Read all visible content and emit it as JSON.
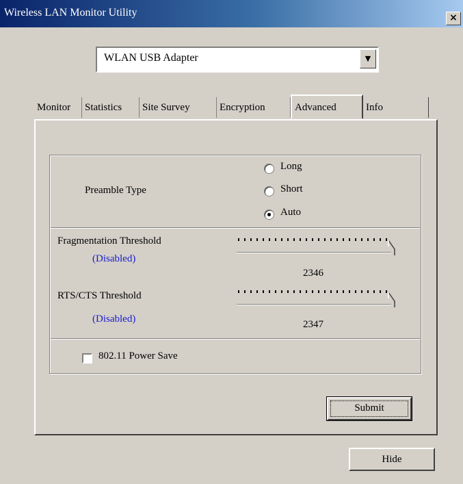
{
  "window": {
    "title": "Wireless LAN Monitor Utility",
    "close_symbol": "×"
  },
  "adapter_select": {
    "value": "WLAN USB Adapter",
    "arrow": "▼"
  },
  "tabs": [
    {
      "label": "Monitor"
    },
    {
      "label": "Statistics"
    },
    {
      "label": "Site Survey"
    },
    {
      "label": "Encryption"
    },
    {
      "label": "Advanced",
      "active": true
    },
    {
      "label": "Info"
    }
  ],
  "preamble": {
    "label": "Preamble Type",
    "options": [
      "Long",
      "Short",
      "Auto"
    ],
    "selected": "Auto"
  },
  "fragmentation": {
    "label": "Fragmentation Threshold",
    "status": "(Disabled)",
    "value": "2346",
    "level": 1.0
  },
  "rts_cts": {
    "label": "RTS/CTS Threshold",
    "status": "(Disabled)",
    "value": "2347",
    "level": 1.0
  },
  "power_save": {
    "label": "802.11 Power Save",
    "checked": false
  },
  "buttons": {
    "submit": "Submit",
    "hide": "Hide"
  },
  "colors": {
    "accent_blue": "#1a1acc",
    "title_bar": "#0a246a"
  }
}
